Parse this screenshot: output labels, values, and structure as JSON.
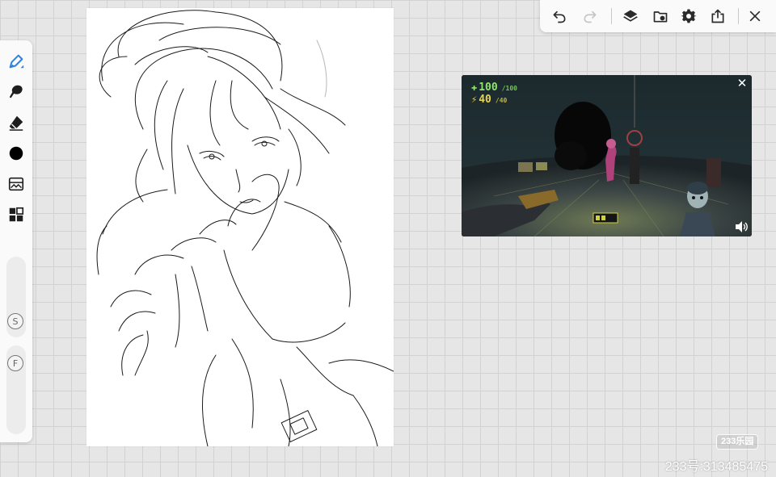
{
  "app": {
    "accent_color": "#2d82e6",
    "current_color": "#000000"
  },
  "left_toolbar": {
    "tools": [
      {
        "name": "brush",
        "icon": "brush-icon",
        "selected": true
      },
      {
        "name": "smudge",
        "icon": "smudge-icon"
      },
      {
        "name": "eraser",
        "icon": "eraser-icon"
      },
      {
        "name": "color",
        "icon": "color-swatch-icon"
      },
      {
        "name": "reference",
        "icon": "gallery-icon"
      },
      {
        "name": "quick-menu",
        "icon": "grid-icon"
      }
    ],
    "size_slider_label": "S",
    "flow_slider_label": "F"
  },
  "top_toolbar": {
    "buttons": [
      {
        "name": "undo",
        "icon": "undo-icon",
        "enabled": true
      },
      {
        "name": "redo",
        "icon": "redo-icon",
        "enabled": false
      },
      {
        "name": "layers",
        "icon": "layers-icon"
      },
      {
        "name": "reference",
        "icon": "gallery-import-icon"
      },
      {
        "name": "settings",
        "icon": "gear-icon"
      },
      {
        "name": "share",
        "icon": "share-icon"
      },
      {
        "name": "close",
        "icon": "close-icon"
      }
    ]
  },
  "video_overlay": {
    "hud_health": "100",
    "hud_health_max": "/100",
    "hud_armor": "40",
    "hud_armor_max": "/40",
    "close_label": "✕"
  },
  "watermark": {
    "logo_text": "233乐园",
    "id_text": "233号:313485475"
  }
}
